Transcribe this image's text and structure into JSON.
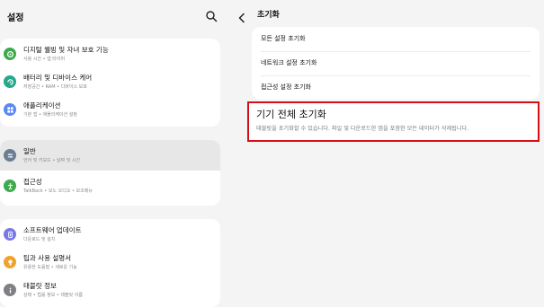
{
  "left_panel": {
    "title": "설정",
    "groups": [
      {
        "items": [
          {
            "title": "디지털 웰빙 및 자녀 보호 기능",
            "subtitle": "사용 시간 • 앱 타이머",
            "icon": "digital-wellbeing-icon",
            "color": "#3daa4c"
          },
          {
            "title": "배터리 및 디바이스 케어",
            "subtitle": "저장공간 • RAM • 디바이스 보호",
            "icon": "device-care-icon",
            "color": "#22a98a"
          },
          {
            "title": "애플리케이션",
            "subtitle": "기본 앱 • 애플리케이션 설정",
            "icon": "apps-icon",
            "color": "#5a87f2"
          }
        ]
      },
      {
        "items": [
          {
            "title": "일반",
            "subtitle": "언어 및 키보드 • 날짜 및 시간",
            "icon": "general-management-icon",
            "color": "#6b7d93",
            "selected": true
          },
          {
            "title": "접근성",
            "subtitle": "TalkBack • 모노 오디오 • 보조메뉴",
            "icon": "accessibility-icon",
            "color": "#3daa4c"
          }
        ]
      },
      {
        "items": [
          {
            "title": "소프트웨어 업데이트",
            "subtitle": "다운로드 및 설치",
            "icon": "software-update-icon",
            "color": "#7a78e8"
          },
          {
            "title": "팁과 사용 설명서",
            "subtitle": "유용한 도움말 • 새로운 기능",
            "icon": "tips-icon",
            "color": "#f0a32c"
          },
          {
            "title": "태블릿 정보",
            "subtitle": "상태 • 법률 정보 • 태블릿 이름",
            "icon": "tablet-info-icon",
            "color": "#7f8084"
          }
        ]
      }
    ]
  },
  "right_panel": {
    "title": "초기화",
    "items": [
      {
        "label": "모든 설정 초기화"
      },
      {
        "label": "네트워크 설정 초기화"
      },
      {
        "label": "접근성 설정 초기화"
      }
    ],
    "factory_reset": {
      "title": "기기 전체 초기화",
      "description": "태블릿을 초기화할 수 있습니다. 파일 및 다운로드한 앱을 포함한 모든 데이터가 삭제됩니다.",
      "highlight_color": "#d90d14"
    }
  }
}
